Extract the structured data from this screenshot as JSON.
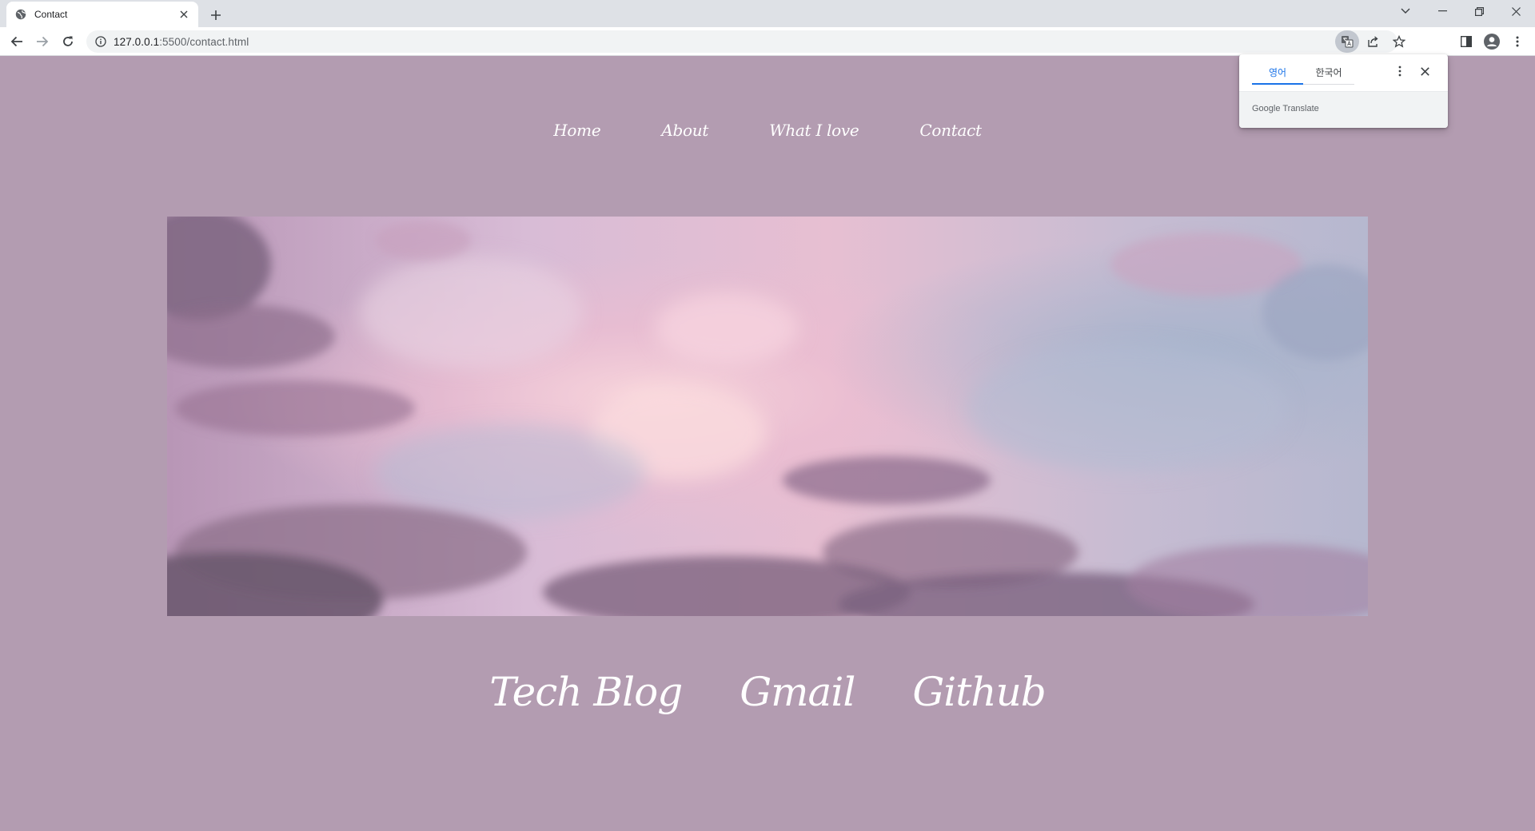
{
  "browser": {
    "tab_title": "Contact",
    "url_host": "127.0.0.1",
    "url_path": ":5500/contact.html"
  },
  "nav": {
    "items": [
      "Home",
      "About",
      "What I love",
      "Contact"
    ]
  },
  "contact_links": [
    "Tech Blog",
    "Gmail",
    "Github"
  ],
  "translate_popup": {
    "source_lang": "영어",
    "target_lang": "한국어",
    "brand": "Google",
    "product": "Translate"
  },
  "colors": {
    "page_background": "#b39cb1",
    "link_text": "#ffffff",
    "active_tab_accent": "#1a73e8"
  }
}
